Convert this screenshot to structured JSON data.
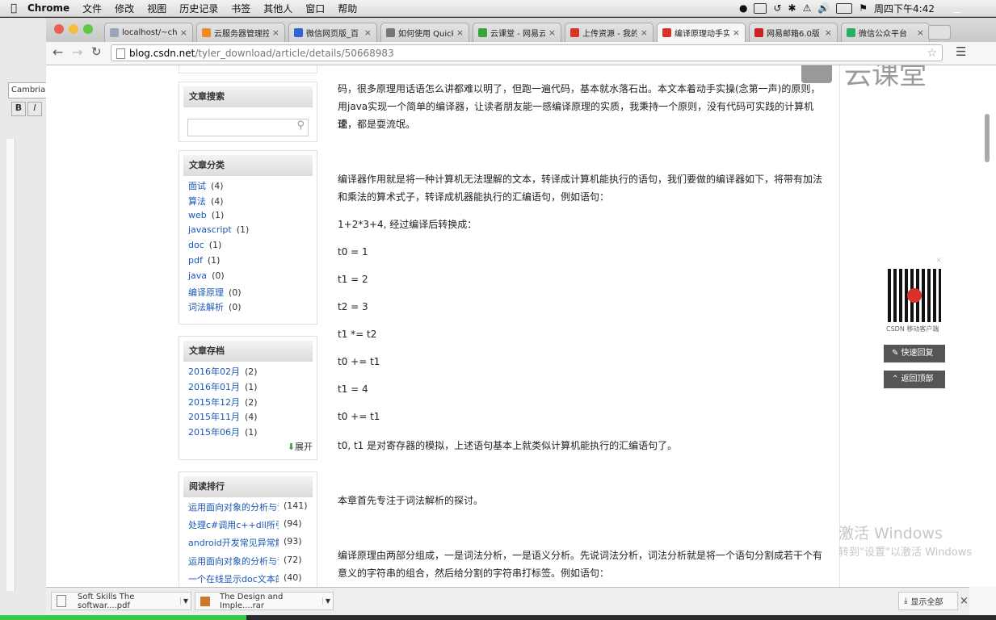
{
  "menubar": {
    "app": "Chrome",
    "items": [
      "文件",
      "修改",
      "视图",
      "历史记录",
      "书签",
      "其他人",
      "窗口",
      "帮助"
    ],
    "clock": "周四下午4:42"
  },
  "tabs": [
    {
      "title": "localhost/~che",
      "color": "#9aa7b8"
    },
    {
      "title": "云服务器管理控",
      "color": "#f08a24"
    },
    {
      "title": "微信网页版_百",
      "color": "#2f63d6"
    },
    {
      "title": "如何使用 Quick",
      "color": "#777777"
    },
    {
      "title": "云课堂 - 网易云",
      "color": "#3aa33a"
    },
    {
      "title": "上传资源 - 我的",
      "color": "#d8322b"
    },
    {
      "title": "编译原理动手实",
      "color": "#d8322b"
    },
    {
      "title": "网易邮箱6.0版",
      "color": "#cc2222"
    },
    {
      "title": "微信公众平台",
      "color": "#2aae67"
    }
  ],
  "address": {
    "host": "blog.csdn.net",
    "path": "/tyler_download/article/details/50668983"
  },
  "watermark": "云课堂",
  "sidebar": {
    "search_title": "文章搜索",
    "categories_title": "文章分类",
    "categories": [
      {
        "name": "面试",
        "count": "(4)"
      },
      {
        "name": "算法",
        "count": "(4)"
      },
      {
        "name": "web",
        "count": "(1)"
      },
      {
        "name": "javascript",
        "count": "(1)"
      },
      {
        "name": "doc",
        "count": "(1)"
      },
      {
        "name": "pdf",
        "count": "(1)"
      },
      {
        "name": "java",
        "count": "(0)"
      },
      {
        "name": "编译原理",
        "count": "(0)"
      },
      {
        "name": "词法解析",
        "count": "(0)"
      }
    ],
    "archive_title": "文章存档",
    "archive": [
      {
        "name": "2016年02月",
        "count": "(2)"
      },
      {
        "name": "2016年01月",
        "count": "(1)"
      },
      {
        "name": "2015年12月",
        "count": "(2)"
      },
      {
        "name": "2015年11月",
        "count": "(4)"
      },
      {
        "name": "2015年06月",
        "count": "(1)"
      }
    ],
    "expand_label": "展开",
    "ranking_title": "阅读排行",
    "ranking": [
      {
        "name": "运用面向对象的分析与设",
        "count": "(141)"
      },
      {
        "name": "处理c#调用c++dll所引起",
        "count": "(94)"
      },
      {
        "name": "android开发常见异常解",
        "count": "(93)"
      },
      {
        "name": "运用面向对象的分析与设",
        "count": "(72)"
      },
      {
        "name": "一个在线显示doc文本的",
        "count": "(40)"
      }
    ]
  },
  "article": {
    "p0a": "码，很多原理用话语怎么讲都难以明了，但跑一遍代码，基本就水落石出。本文本着动手实操(念第一声)的原则，",
    "p0b": "用java实现一个简单的编译器，让读者朋友能一感编译原理的实质，我秉持一个原则，没有代码可实践的计算机理",
    "p0c": "论，都是耍流氓。",
    "p1a": "编译器作用就是将一种计算机无法理解的文本，转译成计算机能执行的语句，我们要做的编译器如下，将带有加法",
    "p1b": "和乘法的算术式子，转译成机器能执行的汇编语句，例如语句：",
    "expr": "1+2*3+4, 经过编译后转换成：",
    "code": [
      "t0 = 1",
      "t1 = 2",
      "t2 = 3",
      "t1 *= t2",
      "t0 += t1",
      "t1 = 4",
      "t0 += t1"
    ],
    "p2": "t0, t1 是对寄存器的模拟，上述语句基本上就类似计算机能执行的汇编语句了。",
    "p3": "本章首先专注于词法解析的探讨。",
    "p4a": "编译原理由两部分组成，一是词法分析，一是语义分析。先说词法分析，词法分析就是将一个语句分割成若干个有",
    "p4b": "意义的字符串的组合，然后给分割的字符串打标签。例如语句："
  },
  "floating": {
    "qr_caption": "CSDN 移动客户端",
    "quick_reply": "快速回复",
    "back_top": "返回顶部"
  },
  "activate": {
    "line1": "激活 Windows",
    "line2": "转到\"设置\"以激活 Windows"
  },
  "shelf": {
    "files": [
      "Soft Skills The softwar....pdf",
      "The Design and Imple....rar"
    ],
    "show_all": "显示全部"
  },
  "word": {
    "font": "Cambria"
  }
}
